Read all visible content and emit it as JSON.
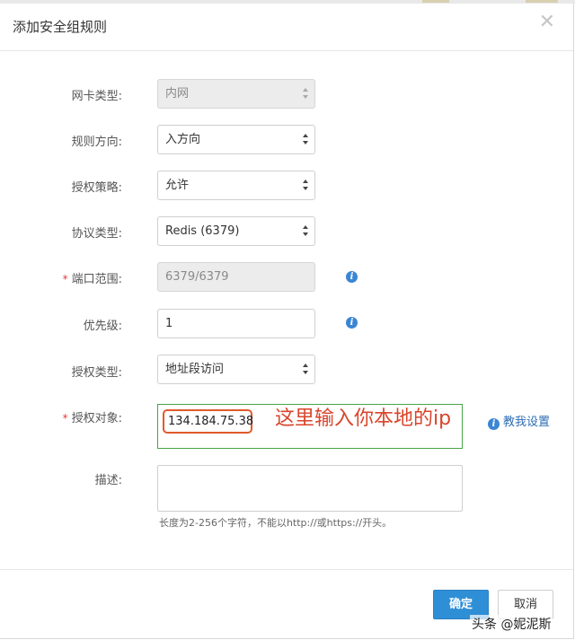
{
  "dialog": {
    "title": "添加安全组规则",
    "close_symbol": "✕"
  },
  "form": {
    "nic_type": {
      "label": "网卡类型:",
      "value": "内网",
      "disabled": true
    },
    "direction": {
      "label": "规则方向:",
      "value": "入方向"
    },
    "policy": {
      "label": "授权策略:",
      "value": "允许"
    },
    "protocol": {
      "label": "协议类型:",
      "value": "Redis (6379)"
    },
    "port_range": {
      "label": "端口范围:",
      "value": "6379/6379",
      "required": true,
      "disabled": true
    },
    "priority": {
      "label": "优先级:",
      "value": "1"
    },
    "auth_type": {
      "label": "授权类型:",
      "value": "地址段访问"
    },
    "auth_target": {
      "label": "授权对象:",
      "value": "134.184.75.38",
      "required": true
    },
    "description": {
      "label": "描述:",
      "value": "",
      "hint": "长度为2-256个字符，不能以http://或https://开头。"
    },
    "required_mark": "*",
    "info_glyph": "i"
  },
  "annotation": {
    "text": "这里输入你本地的ip",
    "color": "#d9452b"
  },
  "help_link": {
    "label": "教我设置"
  },
  "footer": {
    "ok_label": "确定",
    "cancel_label": "取消"
  },
  "watermark": "头条 @妮泥斯",
  "colors": {
    "primary": "#2f8fd6",
    "highlight_border": "#47a447",
    "annotation": "#d9452b",
    "required": "#e4393c",
    "info": "#3a86d4"
  }
}
